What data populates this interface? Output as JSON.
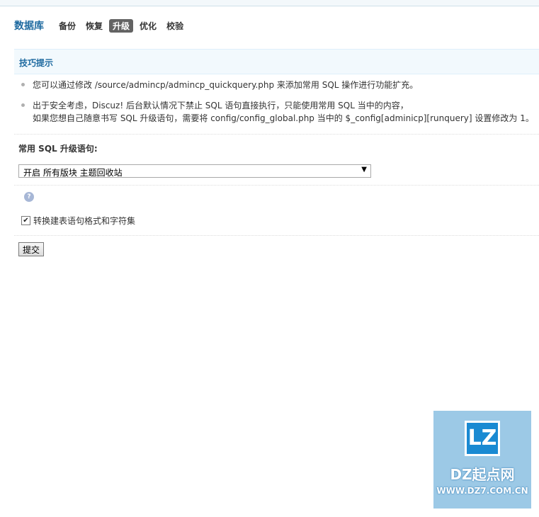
{
  "nav": {
    "title": "数据库",
    "tabs": [
      {
        "label": "备份"
      },
      {
        "label": "恢复"
      },
      {
        "label": "升级",
        "active": true
      },
      {
        "label": "优化"
      },
      {
        "label": "校验"
      }
    ]
  },
  "tips": {
    "heading": "技巧提示",
    "items": [
      "您可以通过修改 /source/admincp/admincp_quickquery.php 来添加常用 SQL 操作进行功能扩充。",
      "出于安全考虑，Discuz! 后台默认情况下禁止 SQL 语句直接执行，只能使用常用 SQL 当中的内容，",
      "如果您想自己随意书写 SQL 升级语句，需要将 config/config_global.php 当中的 $_config[adminicp][runquery] 设置修改为 1。"
    ]
  },
  "form": {
    "label": "常用 SQL 升级语句:",
    "select_value": "开启 所有版块 主题回收站",
    "checkbox_label": "转换建表语句格式和字符集",
    "checkbox_checked": true,
    "submit_label": "提交",
    "help_icon": "question-bubble-icon"
  },
  "watermark": {
    "logo_letters": "LZ",
    "name": "DZ起点网",
    "url": "WWW.DZ7.COM.CN"
  },
  "colors": {
    "accent": "#1e6aa0",
    "active_tab_bg": "#636363",
    "tips_bg": "#f2f9fd",
    "watermark_bg": "#9cc9e6"
  }
}
